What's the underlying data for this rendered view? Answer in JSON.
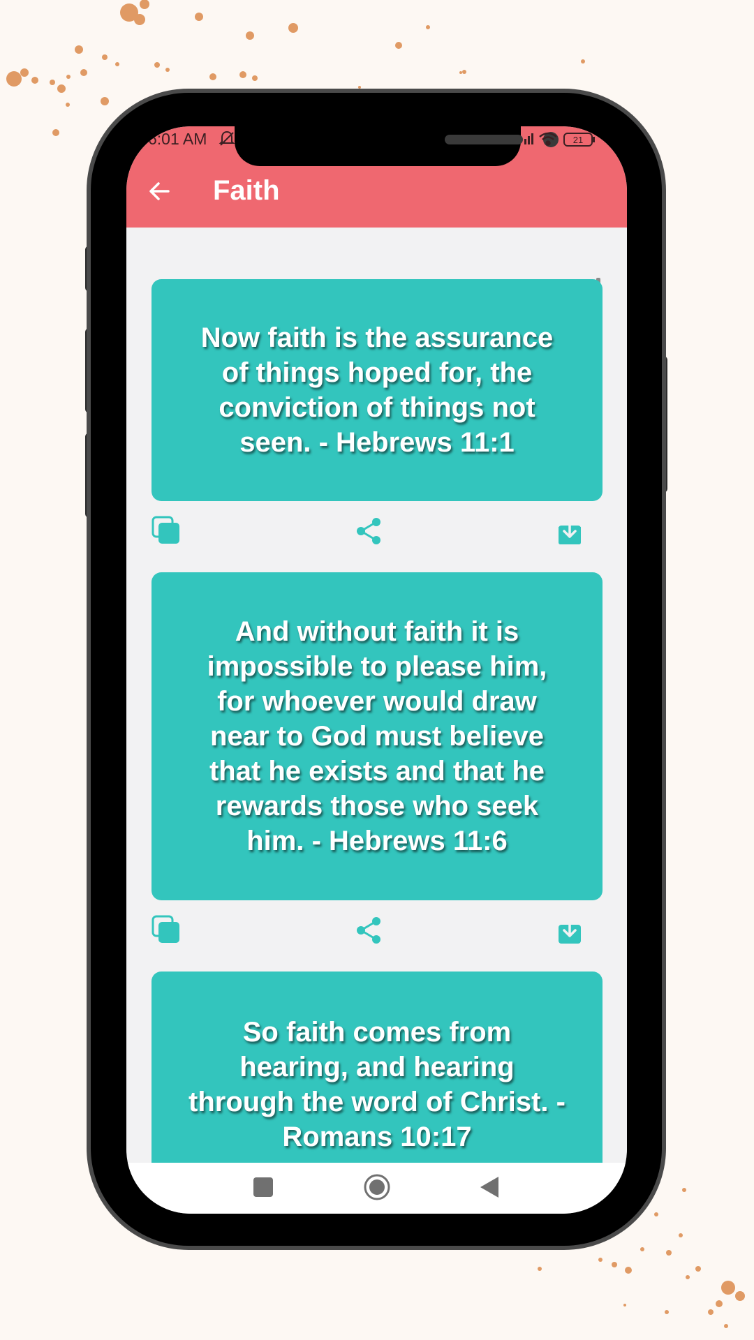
{
  "status_bar": {
    "time": "6:01 AM",
    "battery": "21",
    "icons": [
      "bell-off-icon",
      "signal-icon",
      "wifi-icon",
      "battery-icon"
    ]
  },
  "app_bar": {
    "title": "Faith",
    "back_icon": "arrow-left-icon",
    "background_color": "#ef6870"
  },
  "verses": [
    {
      "text": "Now faith is the assurance of things hoped for, the conviction of things not seen. - Hebrews 11:1"
    },
    {
      "text": "And without faith it is impossible to please him, for whoever would draw near to God must believe that he exists and that he rewards those who seek him. - Hebrews 11:6"
    },
    {
      "text": "So faith comes from hearing, and hearing through the word of Christ. - Romans 10:17"
    }
  ],
  "card_actions": [
    "copy-icon",
    "share-icon",
    "download-icon"
  ],
  "colors": {
    "card": "#33c5bd",
    "icon": "#33c5bd",
    "list_background": "#f2f2f3"
  },
  "nav_bar": {
    "buttons": [
      "recents-button",
      "home-button",
      "back-button"
    ]
  }
}
